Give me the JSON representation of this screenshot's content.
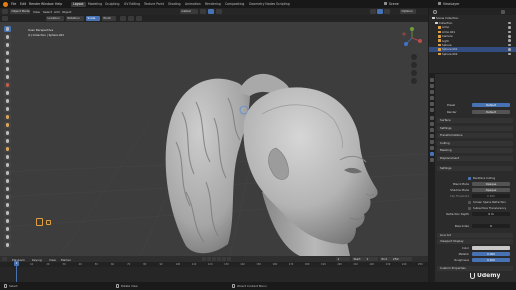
{
  "app": {
    "menus": [
      "File",
      "Edit",
      "Render",
      "Window",
      "Help"
    ],
    "workspaces": [
      "Layout",
      "Modeling",
      "Sculpting",
      "UV Editing",
      "Texture Paint",
      "Shading",
      "Animation",
      "Rendering",
      "Compositing",
      "Geometry Nodes",
      "Scripting"
    ],
    "active_workspace": "Layout",
    "scene": "Scene",
    "view_layer": "ViewLayer"
  },
  "viewport_header": {
    "mode": "Object Mode",
    "view": "View",
    "select": "Select",
    "add": "Add",
    "object": "Object",
    "transform": "Global",
    "options": "Options"
  },
  "tool_header": {
    "location": "Location",
    "rotation": "Rotation",
    "scale": "Scale",
    "pivot": "Pivot"
  },
  "viewport_overlay": {
    "view_name": "User Perspective",
    "collection": "(1) Collection | Sphere.001"
  },
  "outliner": {
    "title": "Scene Collection",
    "rows": [
      {
        "label": "Collection",
        "color": "#d4d4d4",
        "selected": false
      },
      {
        "label": "Armo",
        "color": "#e0a040",
        "selected": false
      },
      {
        "label": "Armo.001",
        "color": "#e0a040",
        "selected": false
      },
      {
        "label": "Camera",
        "color": "#e0a040",
        "selected": false
      },
      {
        "label": "Light",
        "color": "#e0a040",
        "selected": false
      },
      {
        "label": "Sphere",
        "color": "#e0a040",
        "selected": false
      },
      {
        "label": "Sphere.001",
        "color": "#e0a040",
        "selected": true
      },
      {
        "label": "Sphere.002",
        "color": "#e0a040",
        "selected": false
      }
    ]
  },
  "properties": {
    "preset_label": "Preset",
    "preset_value": "Default",
    "render_label": "Render",
    "render_value": "Default",
    "sections_top": [
      "Surface",
      "Settings",
      "Transformations",
      "Culling",
      "Masking",
      "Displacement"
    ],
    "settings_title": "Settings",
    "backface_culling": "Backface Culling",
    "blend_mode_label": "Blend Mode",
    "blend_mode_value": "Opaque",
    "shadow_mode_label": "Shadow Mode",
    "shadow_mode_value": "Opaque",
    "clip_threshold_label": "Clip Threshold",
    "clip_threshold_value": "0.500",
    "screen_space_refraction": "Screen Space Refraction",
    "subsurface_translucency": "Subsurface Translucency",
    "refraction_depth_label": "Refraction Depth",
    "refraction_depth_value": "0 m",
    "pass_index_label": "Pass Index",
    "pass_index_value": "0",
    "sections_bottom": [
      "Line Art",
      "Viewport Display"
    ],
    "color_label": "Color",
    "metallic_label": "Metallic",
    "metallic_value": "0.000",
    "roughness_label": "Roughness",
    "roughness_value": "0.400",
    "custom_props": "Custom Properties"
  },
  "timeline": {
    "menus": [
      "Playback",
      "Keying",
      "View",
      "Marker"
    ],
    "current_frame": "1",
    "start_label": "Start",
    "start_value": "1",
    "end_label": "End",
    "end_value": "250",
    "ticks": [
      "0",
      "10",
      "20",
      "30",
      "40",
      "50",
      "60",
      "70",
      "80",
      "90",
      "100",
      "110",
      "120",
      "130",
      "140",
      "150",
      "160",
      "170",
      "180",
      "190",
      "200",
      "210",
      "220",
      "230",
      "240",
      "250"
    ]
  },
  "status_bar": {
    "left": "Select",
    "middle": "Rotate View",
    "right": "Object Context Menu",
    "watermark": "Udemy"
  },
  "colors": {
    "accent": "#4772b3",
    "viewport_bg": "#3d3d3d",
    "mesh": "#b9b9b9"
  }
}
